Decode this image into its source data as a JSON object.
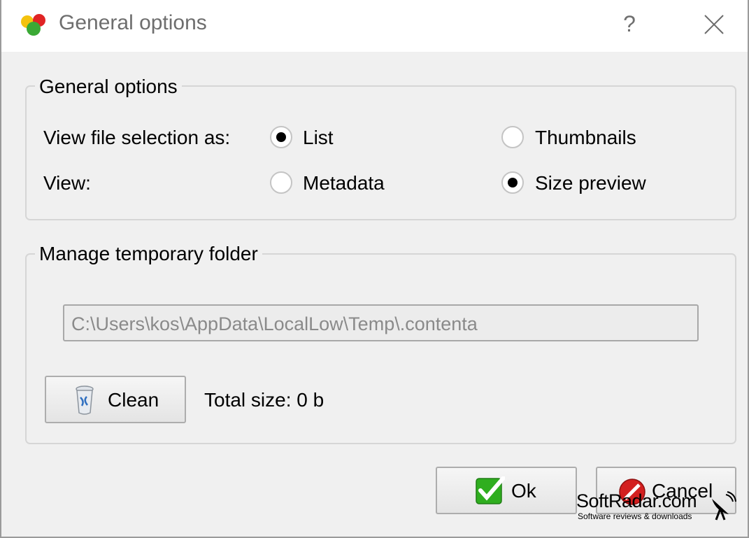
{
  "window": {
    "title": "General options",
    "help_symbol": "?"
  },
  "general_group": {
    "title": "General options",
    "view_selection_label": "View file selection as:",
    "view_label": "View:",
    "options": {
      "list": "List",
      "thumbnails": "Thumbnails",
      "metadata": "Metadata",
      "size_preview": "Size preview"
    },
    "selected": {
      "file_selection": "List",
      "view": "Size preview"
    }
  },
  "temp_group": {
    "title": "Manage temporary folder",
    "path_value": "C:\\Users\\kos\\AppData\\LocalLow\\Temp\\.contenta",
    "clean_label": "Clean",
    "total_size": "Total size: 0 b"
  },
  "footer": {
    "ok_label": "Ok",
    "cancel_label": "Cancel"
  },
  "watermark": {
    "title": "SoftRadar.com",
    "subtitle": "Software reviews & downloads"
  },
  "icons": [
    "app-icon",
    "help-icon",
    "close-icon",
    "trash-icon",
    "checkmark-icon",
    "cancel-icon",
    "satellite-dish-icon"
  ],
  "colors": {
    "titlebar": "#ffffff",
    "window_bg": "#f0f0f0",
    "ok_green": "#2fae1f",
    "cancel_red": "#d31f1f"
  }
}
